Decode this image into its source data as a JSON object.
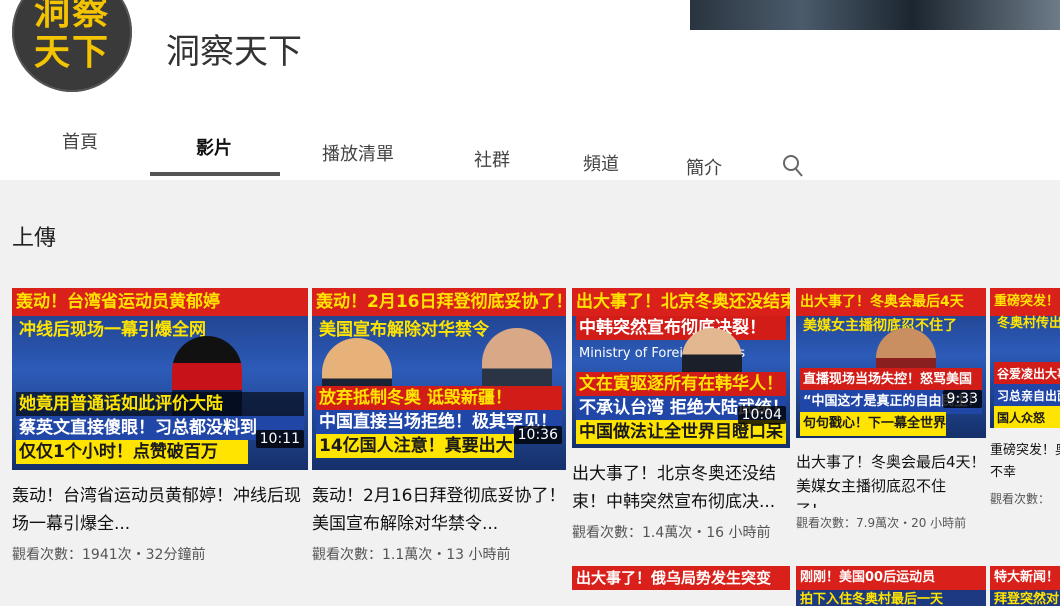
{
  "channel": {
    "avatar_line1": "洞察",
    "avatar_line2": "天下",
    "name": "洞察天下"
  },
  "tabs": [
    {
      "label": "首頁",
      "selected": false
    },
    {
      "label": "影片",
      "selected": true
    },
    {
      "label": "播放清單",
      "selected": false
    },
    {
      "label": "社群",
      "selected": false
    },
    {
      "label": "頻道",
      "selected": false
    },
    {
      "label": "簡介",
      "selected": false
    }
  ],
  "search_icon": "search-icon",
  "section_title": "上傳",
  "videos": [
    {
      "thumb_lines": [
        "轰动！台湾省运动员黄郁婷",
        "冲线后现场一幕引爆全网",
        "她竟用普通话如此评价大陆",
        "蔡英文直接傻眼！习总都没料到",
        "仅仅1个小时！点赞破百万"
      ],
      "duration": "10:11",
      "title": "轰动！台湾省运动员黄郁婷！冲线后现场一幕引爆全...",
      "meta": "觀看次數：1941次・32分鐘前"
    },
    {
      "thumb_lines": [
        "轰动！2月16日拜登彻底妥协了！",
        "美国宣布解除对华禁令",
        "放弃抵制冬奥 诋毁新疆！",
        "中国直接当场拒绝！极其罕见！",
        "14亿国人注意！真要出大"
      ],
      "duration": "10:36",
      "title": "轰动！2月16日拜登彻底妥协了！美国宣布解除对华禁令...",
      "meta": "觀看次數：1.1萬次・13 小時前"
    },
    {
      "thumb_lines": [
        "出大事了！北京冬奥还没结束",
        "中韩突然宣布彻底决裂！",
        "Ministry of Foreign Affairs",
        "文在寅驱逐所有在韩华人！",
        "不承认台湾 拒绝大陆武统！",
        "中国做法让全世界目瞪口呆"
      ],
      "duration": "10:04",
      "title": "出大事了！北京冬奥还没结束！中韩突然宣布彻底决...",
      "meta": "觀看次數：1.4萬次・16 小時前"
    },
    {
      "thumb_lines": [
        "出大事了！冬奥会最后4天",
        "美媒女主播彻底忍不住了",
        "直播现场当场失控！怒骂美国",
        "“中国这才是真正的自由民主！”",
        "句句戳心！下一幕全世界沸"
      ],
      "duration": "9:33",
      "title": "出大事了！冬奥会最后4天！美媒女主播彻底忍不住了！...",
      "meta": "觀看次數：7.9萬次・20 小時前"
    },
    {
      "thumb_lines": [
        "重磅突发！",
        "冬奥村传出",
        "谷爱凌出大事",
        "习总亲自出面",
        "国人众怒"
      ],
      "duration": "",
      "title": "重磅突发！奥村传出不幸",
      "meta": "觀看次數："
    }
  ],
  "next_row": [
    {
      "line1": "",
      "line2": ""
    },
    {
      "line1": "",
      "line2": ""
    },
    {
      "line1": "出大事了！俄乌局势发生突变",
      "line2": ""
    },
    {
      "line1": "刚刚！美国00后运动员",
      "line2": "拍下入住冬奥村最后一天"
    },
    {
      "line1": "特大新闻！",
      "line2": "拜登突然对"
    }
  ]
}
